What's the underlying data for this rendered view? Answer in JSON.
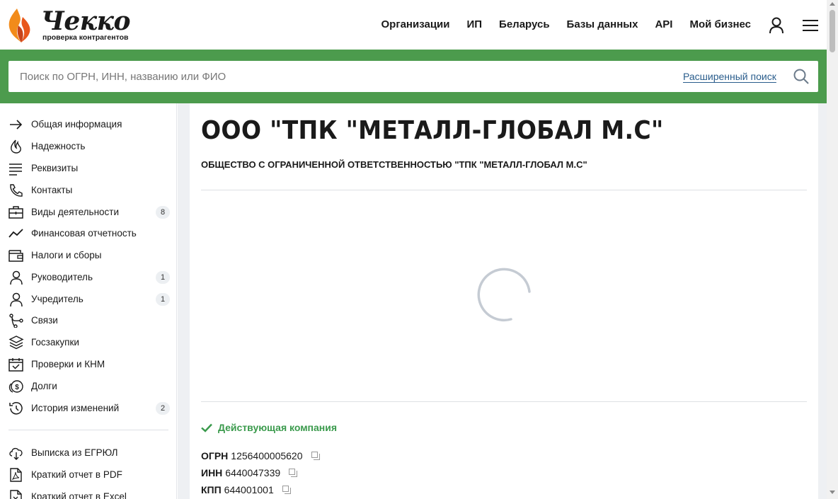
{
  "brand": {
    "name": "Чекко",
    "tagline": "проверка контрагентов",
    "accent_color": "#4c9b4d",
    "flame_colors": [
      "#f28b1a",
      "#e8571c"
    ]
  },
  "topnav": {
    "items": [
      "Организации",
      "ИП",
      "Беларусь",
      "Базы данных",
      "API",
      "Мой бизнес"
    ],
    "user_icon": "user-icon",
    "menu_icon": "hamburger-menu-icon"
  },
  "search": {
    "placeholder": "Поиск по ОГРН, ИНН, названию или ФИО",
    "advanced_label": "Расширенный поиск"
  },
  "sidebar": {
    "items": [
      {
        "label": "Общая информация",
        "icon": "arrow-right-icon"
      },
      {
        "label": "Надежность",
        "icon": "flame-outline-icon"
      },
      {
        "label": "Реквизиты",
        "icon": "lines-icon"
      },
      {
        "label": "Контакты",
        "icon": "phone-icon"
      },
      {
        "label": "Виды деятельности",
        "icon": "briefcase-icon",
        "count": "8"
      },
      {
        "label": "Финансовая отчетность",
        "icon": "trend-line-icon"
      },
      {
        "label": "Налоги и сборы",
        "icon": "wallet-icon"
      },
      {
        "label": "Руководитель",
        "icon": "person-icon",
        "count": "1"
      },
      {
        "label": "Учредитель",
        "icon": "person-icon",
        "count": "1"
      },
      {
        "label": "Связи",
        "icon": "connections-icon"
      },
      {
        "label": "Госзакупки",
        "icon": "layers-icon"
      },
      {
        "label": "Проверки и КНМ",
        "icon": "calendar-check-icon"
      },
      {
        "label": "Долги",
        "icon": "coins-icon"
      },
      {
        "label": "История изменений",
        "icon": "history-icon",
        "count": "2"
      }
    ],
    "downloads": [
      {
        "label": "Выписка из ЕГРЮЛ",
        "icon": "cloud-download-icon"
      },
      {
        "label": "Краткий отчет в PDF",
        "icon": "pdf-icon"
      },
      {
        "label": "Краткий отчет в Excel",
        "icon": "excel-icon"
      }
    ]
  },
  "company": {
    "short_name": "ООО \"ТПК \"МЕТАЛЛ-ГЛОБАЛ М.С\"",
    "full_name": "ОБЩЕСТВО С ОГРАНИЧЕННОЙ ОТВЕТСТВЕННОСТЬЮ \"ТПК \"МЕТАЛЛ-ГЛОБАЛ М.С\"",
    "status": "Действующая компания",
    "status_color": "#3a9a4c",
    "registry": [
      {
        "key": "ОГРН",
        "value": "1256400005620"
      },
      {
        "key": "ИНН",
        "value": "6440047339"
      },
      {
        "key": "КПП",
        "value": "644001001"
      }
    ]
  }
}
